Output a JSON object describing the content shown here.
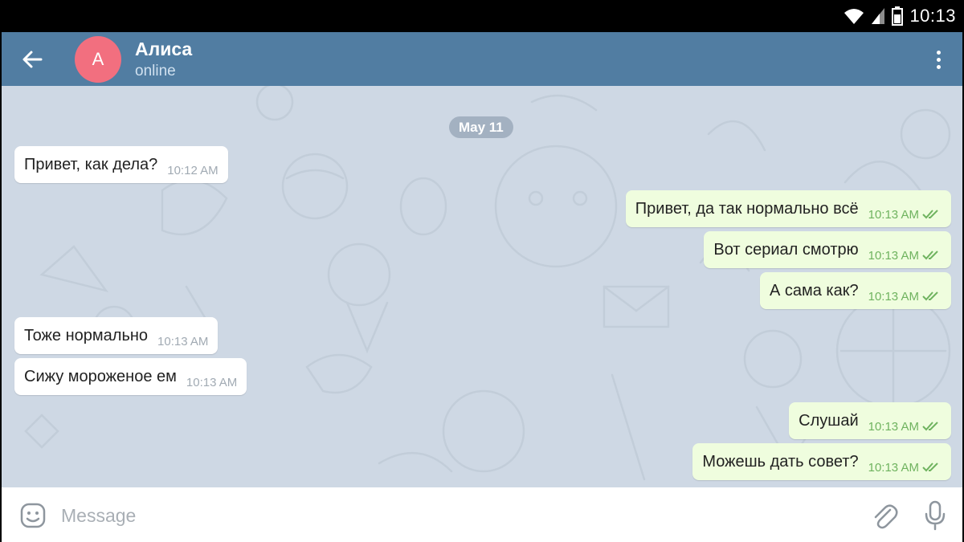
{
  "status_bar": {
    "time": "10:13",
    "icons": [
      "wifi-icon",
      "signal-icon",
      "battery-icon"
    ]
  },
  "header": {
    "back_icon": "arrow-left-icon",
    "avatar_letter": "A",
    "avatar_color": "#f26f7f",
    "name": "Алиса",
    "status": "online",
    "menu_icon": "more-vertical-icon",
    "color": "#517da2"
  },
  "chat": {
    "date_label": "May 11",
    "messages": [
      {
        "direction": "in",
        "text": "Привет, как дела?",
        "time": "10:12 AM"
      },
      {
        "direction": "out",
        "text": "Привет, да так нормально всё",
        "time": "10:13 AM",
        "read": true
      },
      {
        "direction": "out",
        "text": "Вот сериал смотрю",
        "time": "10:13 AM",
        "read": true
      },
      {
        "direction": "out",
        "text": "А сама как?",
        "time": "10:13 AM",
        "read": true
      },
      {
        "direction": "in",
        "text": "Тоже нормально",
        "time": "10:13 AM"
      },
      {
        "direction": "in",
        "text": "Сижу мороженое ем",
        "time": "10:13 AM"
      },
      {
        "direction": "out",
        "text": "Слушай",
        "time": "10:13 AM",
        "read": true
      },
      {
        "direction": "out",
        "text": "Можешь дать совет?",
        "time": "10:13 AM",
        "read": true
      }
    ],
    "incoming_bubble_color": "#ffffff",
    "outgoing_bubble_color": "#effdde",
    "read_check_color": "#6fb35f"
  },
  "input_bar": {
    "placeholder": "Message",
    "value": "",
    "icons": [
      "emoji-icon",
      "paperclip-icon",
      "microphone-icon"
    ]
  }
}
